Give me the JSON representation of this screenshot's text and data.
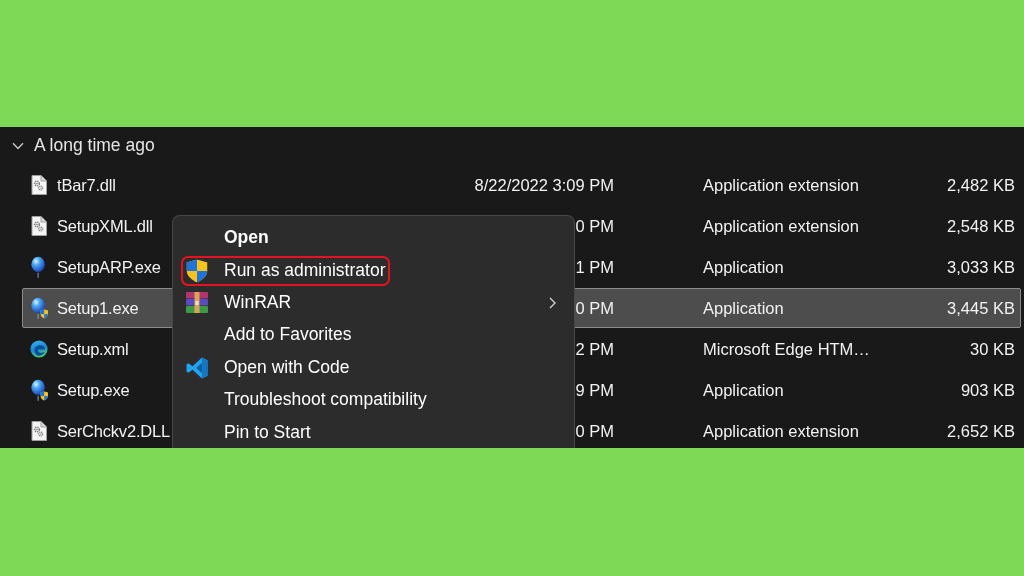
{
  "group": {
    "label": "A long time ago",
    "expanded": true
  },
  "files": [
    {
      "kind": "dll",
      "name": "tBar7.dll",
      "date": "8/22/2022 3:09 PM",
      "type": "Application extension",
      "size": "2,482 KB",
      "selected": false
    },
    {
      "kind": "dll",
      "name": "SetupXML.dll",
      "date": "0 PM",
      "type": "Application extension",
      "size": "2,548 KB",
      "selected": false
    },
    {
      "kind": "app",
      "name": "SetupARP.exe",
      "date": "1 PM",
      "type": "Application",
      "size": "3,033 KB",
      "selected": false
    },
    {
      "kind": "elevated",
      "name": "Setup1.exe",
      "date": "0 PM",
      "type": "Application",
      "size": "3,445 KB",
      "selected": true
    },
    {
      "kind": "xml",
      "name": "Setup.xml",
      "date": "2 PM",
      "type": "Microsoft Edge HTM…",
      "size": "30 KB",
      "selected": false
    },
    {
      "kind": "elevated",
      "name": "Setup.exe",
      "date": "9 PM",
      "type": "Application",
      "size": "903 KB",
      "selected": false
    },
    {
      "kind": "dll",
      "name": "SerChckv2.DLL",
      "date": "0 PM",
      "type": "Application extension",
      "size": "2,652 KB",
      "selected": false
    }
  ],
  "context_menu": {
    "items": [
      {
        "kind": "plain",
        "label": "Open",
        "default": true,
        "highlighted": false,
        "submenu": false
      },
      {
        "kind": "elevated",
        "label": "Run as administrator",
        "default": false,
        "highlighted": true,
        "submenu": false
      },
      {
        "kind": "archive",
        "label": "WinRAR",
        "default": false,
        "highlighted": false,
        "submenu": true
      },
      {
        "kind": "plain",
        "label": "Add to Favorites",
        "default": false,
        "highlighted": false,
        "submenu": false
      },
      {
        "kind": "editor",
        "label": "Open with Code",
        "default": false,
        "highlighted": false,
        "submenu": false
      },
      {
        "kind": "plain",
        "label": "Troubleshoot compatibility",
        "default": false,
        "highlighted": false,
        "submenu": false
      },
      {
        "kind": "plain",
        "label": "Pin to Start",
        "default": false,
        "highlighted": false,
        "submenu": false
      }
    ]
  }
}
